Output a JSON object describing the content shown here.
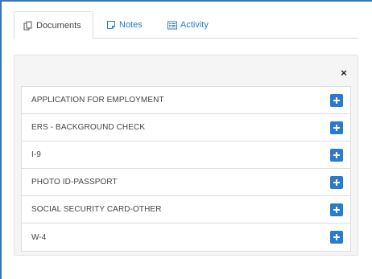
{
  "tabs": [
    {
      "label": "Documents",
      "icon": "copy-icon",
      "active": true
    },
    {
      "label": "Notes",
      "icon": "note-icon",
      "active": false
    },
    {
      "label": "Activity",
      "icon": "list-icon",
      "active": false
    }
  ],
  "panel": {
    "close_icon": "close-icon",
    "close_glyph": "×",
    "items": [
      {
        "label": "APPLICATION FOR EMPLOYMENT",
        "action_icon": "plus-icon"
      },
      {
        "label": "ERS - BACKGROUND CHECK",
        "action_icon": "plus-icon"
      },
      {
        "label": "I-9",
        "action_icon": "plus-icon"
      },
      {
        "label": "PHOTO ID-PASSPORT",
        "action_icon": "plus-icon"
      },
      {
        "label": "SOCIAL SECURITY CARD-OTHER",
        "action_icon": "plus-icon"
      },
      {
        "label": "W-4",
        "action_icon": "plus-icon"
      }
    ]
  },
  "colors": {
    "accent": "#2a7bd0",
    "frame_border": "#3b73b9",
    "panel_bg": "#f5f5f5"
  }
}
